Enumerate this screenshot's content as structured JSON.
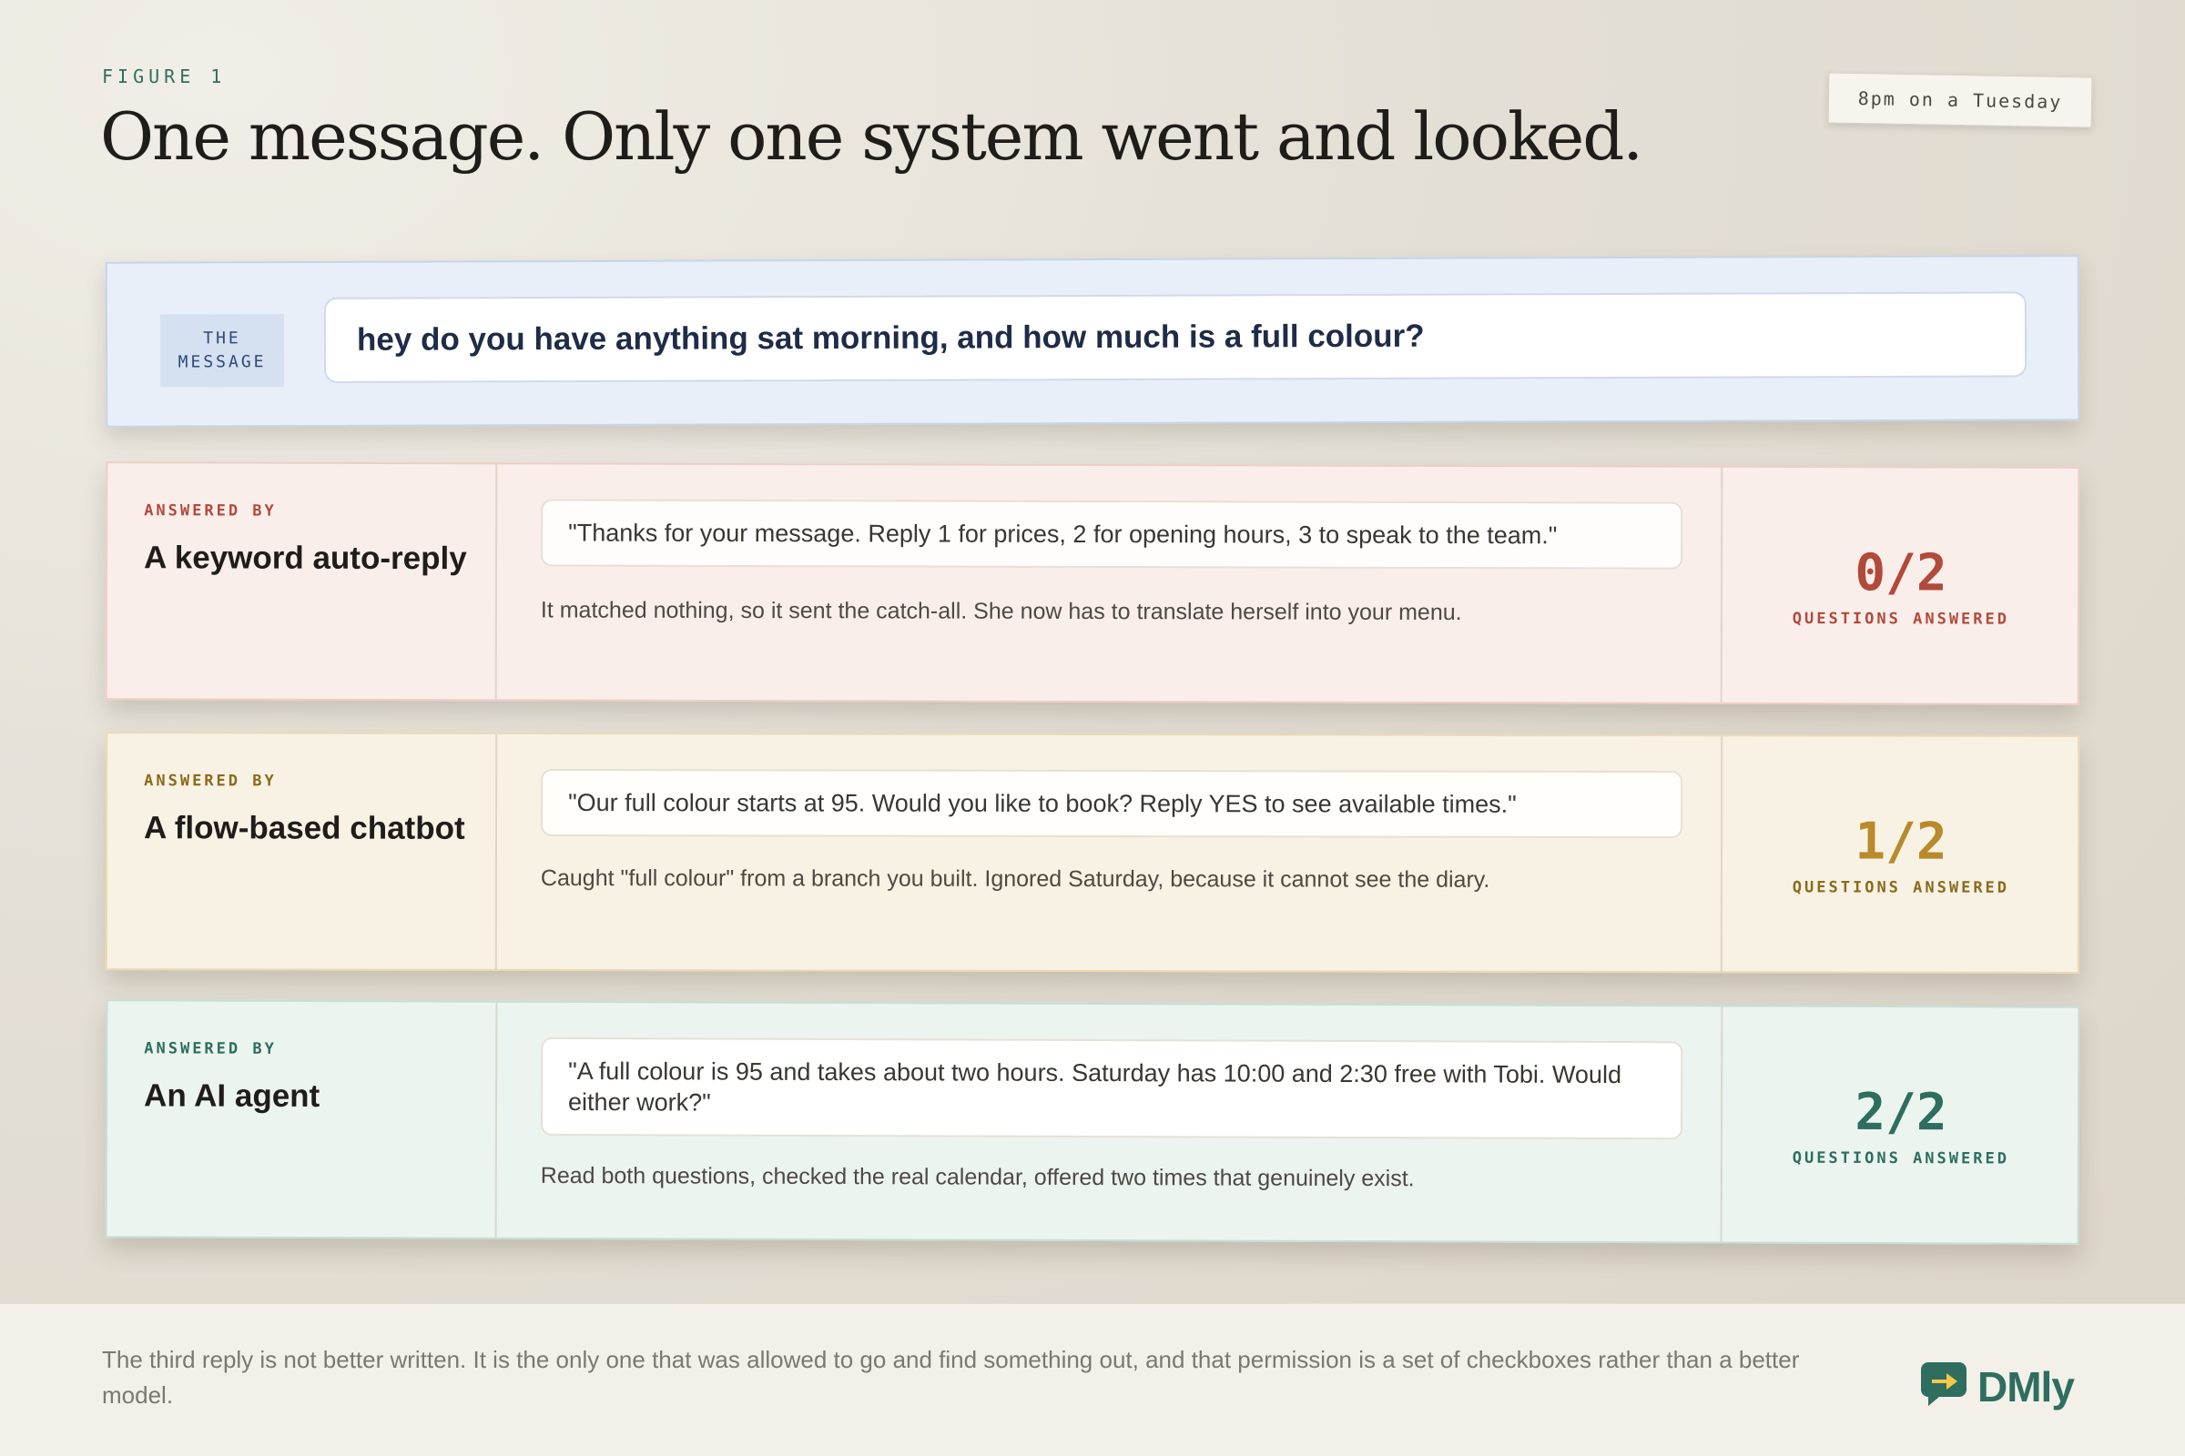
{
  "figure": {
    "label": "FIGURE 1",
    "headline": "One message. Only one system went and looked.",
    "time_tag": "8pm on a Tuesday"
  },
  "message": {
    "badge_line1": "THE",
    "badge_line2": "MESSAGE",
    "text": "hey do you have anything sat morning, and how much is a full colour?"
  },
  "rows": [
    {
      "answered_by": "ANSWERED BY",
      "system": "A keyword auto-reply",
      "reply": "\"Thanks for your message. Reply 1 for prices, 2 for opening hours, 3 to speak to the team.\"",
      "caption": "It matched nothing, so it sent the catch-all. She now has to translate herself into your menu.",
      "score": "0/2",
      "score_label": "QUESTIONS ANSWERED",
      "accent": "#b14a3a"
    },
    {
      "answered_by": "ANSWERED BY",
      "system": "A flow-based chatbot",
      "reply": "\"Our full colour starts at 95. Would you like to book? Reply YES to see available times.\"",
      "caption": "Caught \"full colour\" from a branch you built. Ignored Saturday, because it cannot see the diary.",
      "score": "1/2",
      "score_label": "QUESTIONS ANSWERED",
      "accent": "#b88a2a"
    },
    {
      "answered_by": "ANSWERED BY",
      "system": "An AI agent",
      "reply": "\"A full colour is 95 and takes about two hours. Saturday has 10:00 and 2:30 free with Tobi. Would either work?\"",
      "caption": "Read both questions, checked the real calendar, offered two times that genuinely exist.",
      "score": "2/2",
      "score_label": "QUESTIONS ANSWERED",
      "accent": "#2d6e5e"
    }
  ],
  "footer": {
    "text": "The third reply is not better written. It is the only one that was allowed to go and find something out, and that permission is a set of checkboxes rather than a better model.",
    "logo_text": "DMly",
    "logo_icon": "chat-arrow-icon",
    "brand_color": "#2f6e5e"
  }
}
